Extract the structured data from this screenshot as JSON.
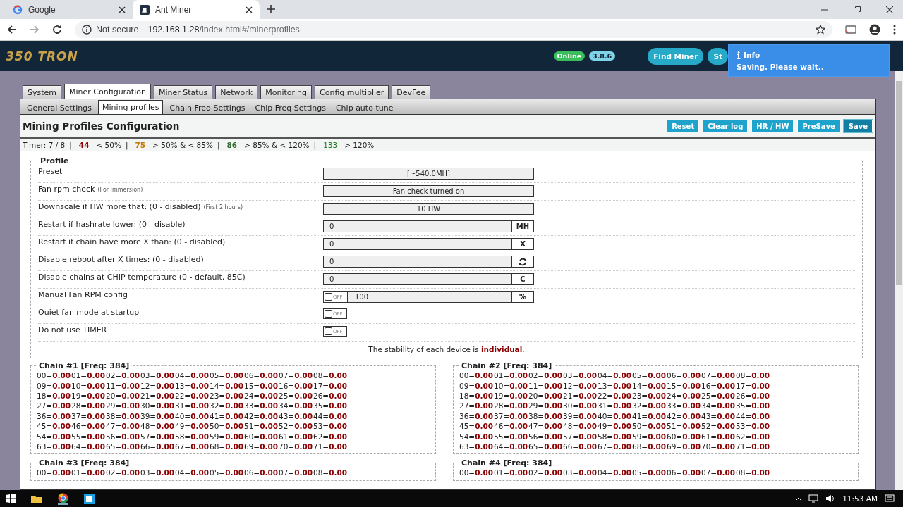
{
  "browser": {
    "tabs": [
      {
        "title": "Google",
        "selected": false
      },
      {
        "title": "Ant Miner",
        "selected": true
      }
    ],
    "security": "Not secure",
    "url_host": "192.168.1.28",
    "url_path": "/index.html#/minerprofiles"
  },
  "header": {
    "logo": "350 TRON",
    "badges": [
      {
        "label": "Online",
        "kind": "status"
      },
      {
        "label": "3.8.6",
        "kind": "version"
      }
    ],
    "buttons": [
      "Find Miner",
      "St"
    ]
  },
  "toast": {
    "title": "Info",
    "message": "Saving. Please wait.."
  },
  "main_tabs": [
    {
      "label": "System",
      "selected": false
    },
    {
      "label": "Miner Configuration",
      "selected": true
    },
    {
      "label": "Miner Status",
      "selected": false
    },
    {
      "label": "Network",
      "selected": false
    },
    {
      "label": "Monitoring",
      "selected": false
    },
    {
      "label": "Config multiplier",
      "selected": false
    },
    {
      "label": "DevFee",
      "selected": false
    }
  ],
  "sub_tabs": [
    {
      "label": "General Settings",
      "selected": false
    },
    {
      "label": "Mining profiles",
      "selected": true
    },
    {
      "label": "Chain Freq Settings",
      "selected": false
    },
    {
      "label": "Chip Freq Settings",
      "selected": false
    },
    {
      "label": "Chip auto tune",
      "selected": false
    }
  ],
  "title": "Mining Profiles Configuration",
  "actions": [
    {
      "label": "Reset",
      "pressed": false
    },
    {
      "label": "Clear log",
      "pressed": false
    },
    {
      "label": "HR / HW",
      "pressed": false
    },
    {
      "label": "PreSave",
      "pressed": false
    },
    {
      "label": "Save",
      "pressed": true
    }
  ],
  "timer": {
    "label": "Timer: 7 / 8",
    "legend": [
      {
        "separator": "|",
        "count": "44",
        "range": "< 50%",
        "color": "#8b0000"
      },
      {
        "separator": "|",
        "count": "75",
        "range": "> 50% & < 85%",
        "color": "#c07800"
      },
      {
        "separator": "|",
        "count": "86",
        "range": "> 85% & < 120%",
        "color": "#2e6b2e"
      },
      {
        "separator": "|",
        "count": "133",
        "range": "> 120%",
        "color": "#1e7a1e"
      }
    ]
  },
  "profile": {
    "legend": "Profile",
    "rows": [
      {
        "label": "Preset",
        "kind": "select",
        "value": "[~540.0MH]"
      },
      {
        "label": "Fan rpm check",
        "note": "(For Immersion)",
        "kind": "select",
        "value": "Fan check turned on"
      },
      {
        "label": "Downscale if HW more that: (0 - disabled)",
        "note": "(First 2 hours)",
        "kind": "select",
        "value": "10 HW"
      },
      {
        "label": "Restart if hashrate lower: (0 - disable)",
        "kind": "input",
        "value": "0",
        "unit": "MH"
      },
      {
        "label": "Restart if chain have more X than: (0 - disabled)",
        "kind": "input",
        "value": "0",
        "unit": "X"
      },
      {
        "label": "Disable reboot after X times: (0 - disabled)",
        "kind": "input-icon",
        "value": "0"
      },
      {
        "label": "Disable chains at CHIP temperature (0 - default, 85C)",
        "kind": "input",
        "value": "0",
        "unit": "C"
      },
      {
        "label": "Manual Fan RPM config",
        "kind": "toggle-input",
        "checked": false,
        "toggle_label": "OFF",
        "value": "100",
        "unit": "%"
      },
      {
        "label": "Quiet fan mode at startup",
        "kind": "toggle",
        "checked": false,
        "toggle_label": "OFF"
      },
      {
        "label": "Do not use TIMER",
        "kind": "toggle",
        "checked": false,
        "toggle_label": "OFF"
      }
    ],
    "footer": "The stability of each device is **individual**."
  },
  "chains": [
    {
      "title": "Chain #1 [Freq: 384]",
      "separator": "=",
      "rows": [
        [
          {
            "chip": "00",
            "value": "0.00"
          },
          {
            "chip": "01",
            "value": "0.00"
          },
          {
            "chip": "02",
            "value": "0.00"
          },
          {
            "chip": "03",
            "value": "0.00"
          },
          {
            "chip": "04",
            "value": "0.00"
          },
          {
            "chip": "05",
            "value": "0.00"
          },
          {
            "chip": "06",
            "value": "0.00"
          },
          {
            "chip": "07",
            "value": "0.00"
          },
          {
            "chip": "08",
            "value": "0.00"
          }
        ],
        [
          {
            "chip": "09",
            "value": "0.00"
          },
          {
            "chip": "10",
            "value": "0.00"
          },
          {
            "chip": "11",
            "value": "0.00"
          },
          {
            "chip": "12",
            "value": "0.00"
          },
          {
            "chip": "13",
            "value": "0.00"
          },
          {
            "chip": "14",
            "value": "0.00"
          },
          {
            "chip": "15",
            "value": "0.00"
          },
          {
            "chip": "16",
            "value": "0.00"
          },
          {
            "chip": "17",
            "value": "0.00"
          }
        ],
        [
          {
            "chip": "18",
            "value": "0.00"
          },
          {
            "chip": "19",
            "value": "0.00"
          },
          {
            "chip": "20",
            "value": "0.00"
          },
          {
            "chip": "21",
            "value": "0.00"
          },
          {
            "chip": "22",
            "value": "0.00"
          },
          {
            "chip": "23",
            "value": "0.00"
          },
          {
            "chip": "24",
            "value": "0.00"
          },
          {
            "chip": "25",
            "value": "0.00"
          },
          {
            "chip": "26",
            "value": "0.00"
          }
        ],
        [
          {
            "chip": "27",
            "value": "0.00"
          },
          {
            "chip": "28",
            "value": "0.00"
          },
          {
            "chip": "29",
            "value": "0.00"
          },
          {
            "chip": "30",
            "value": "0.00"
          },
          {
            "chip": "31",
            "value": "0.00"
          },
          {
            "chip": "32",
            "value": "0.00"
          },
          {
            "chip": "33",
            "value": "0.00"
          },
          {
            "chip": "34",
            "value": "0.00"
          },
          {
            "chip": "35",
            "value": "0.00"
          }
        ],
        [
          {
            "chip": "36",
            "value": "0.00"
          },
          {
            "chip": "37",
            "value": "0.00"
          },
          {
            "chip": "38",
            "value": "0.00"
          },
          {
            "chip": "39",
            "value": "0.00"
          },
          {
            "chip": "40",
            "value": "0.00"
          },
          {
            "chip": "41",
            "value": "0.00"
          },
          {
            "chip": "42",
            "value": "0.00"
          },
          {
            "chip": "43",
            "value": "0.00"
          },
          {
            "chip": "44",
            "value": "0.00"
          }
        ],
        [
          {
            "chip": "45",
            "value": "0.00"
          },
          {
            "chip": "46",
            "value": "0.00"
          },
          {
            "chip": "47",
            "value": "0.00"
          },
          {
            "chip": "48",
            "value": "0.00"
          },
          {
            "chip": "49",
            "value": "0.00"
          },
          {
            "chip": "50",
            "value": "0.00"
          },
          {
            "chip": "51",
            "value": "0.00"
          },
          {
            "chip": "52",
            "value": "0.00"
          },
          {
            "chip": "53",
            "value": "0.00"
          }
        ],
        [
          {
            "chip": "54",
            "value": "0.00"
          },
          {
            "chip": "55",
            "value": "0.00"
          },
          {
            "chip": "56",
            "value": "0.00"
          },
          {
            "chip": "57",
            "value": "0.00"
          },
          {
            "chip": "58",
            "value": "0.00"
          },
          {
            "chip": "59",
            "value": "0.00"
          },
          {
            "chip": "60",
            "value": "0.00"
          },
          {
            "chip": "61",
            "value": "0.00"
          },
          {
            "chip": "62",
            "value": "0.00"
          }
        ],
        [
          {
            "chip": "63",
            "value": "0.00"
          },
          {
            "chip": "64",
            "value": "0.00"
          },
          {
            "chip": "65",
            "value": "0.00"
          },
          {
            "chip": "66",
            "value": "0.00"
          },
          {
            "chip": "67",
            "value": "0.00"
          },
          {
            "chip": "68",
            "value": "0.00"
          },
          {
            "chip": "69",
            "value": "0.00"
          },
          {
            "chip": "70",
            "value": "0.00"
          },
          {
            "chip": "71",
            "value": "0.00"
          }
        ]
      ]
    },
    {
      "title": "Chain #2 [Freq: 384]",
      "separator": "=",
      "rows": [
        [
          {
            "chip": "00",
            "value": "0.00"
          },
          {
            "chip": "01",
            "value": "0.00"
          },
          {
            "chip": "02",
            "value": "0.00"
          },
          {
            "chip": "03",
            "value": "0.00"
          },
          {
            "chip": "04",
            "value": "0.00"
          },
          {
            "chip": "05",
            "value": "0.00"
          },
          {
            "chip": "06",
            "value": "0.00"
          },
          {
            "chip": "07",
            "value": "0.00"
          },
          {
            "chip": "08",
            "value": "0.00"
          }
        ],
        [
          {
            "chip": "09",
            "value": "0.00"
          },
          {
            "chip": "10",
            "value": "0.00"
          },
          {
            "chip": "11",
            "value": "0.00"
          },
          {
            "chip": "12",
            "value": "0.00"
          },
          {
            "chip": "13",
            "value": "0.00"
          },
          {
            "chip": "14",
            "value": "0.00"
          },
          {
            "chip": "15",
            "value": "0.00"
          },
          {
            "chip": "16",
            "value": "0.00"
          },
          {
            "chip": "17",
            "value": "0.00"
          }
        ],
        [
          {
            "chip": "18",
            "value": "0.00"
          },
          {
            "chip": "19",
            "value": "0.00"
          },
          {
            "chip": "20",
            "value": "0.00"
          },
          {
            "chip": "21",
            "value": "0.00"
          },
          {
            "chip": "22",
            "value": "0.00"
          },
          {
            "chip": "23",
            "value": "0.00"
          },
          {
            "chip": "24",
            "value": "0.00"
          },
          {
            "chip": "25",
            "value": "0.00"
          },
          {
            "chip": "26",
            "value": "0.00"
          }
        ],
        [
          {
            "chip": "27",
            "value": "0.00"
          },
          {
            "chip": "28",
            "value": "0.00"
          },
          {
            "chip": "29",
            "value": "0.00"
          },
          {
            "chip": "30",
            "value": "0.00"
          },
          {
            "chip": "31",
            "value": "0.00"
          },
          {
            "chip": "32",
            "value": "0.00"
          },
          {
            "chip": "33",
            "value": "0.00"
          },
          {
            "chip": "34",
            "value": "0.00"
          },
          {
            "chip": "35",
            "value": "0.00"
          }
        ],
        [
          {
            "chip": "36",
            "value": "0.00"
          },
          {
            "chip": "37",
            "value": "0.00"
          },
          {
            "chip": "38",
            "value": "0.00"
          },
          {
            "chip": "39",
            "value": "0.00"
          },
          {
            "chip": "40",
            "value": "0.00"
          },
          {
            "chip": "41",
            "value": "0.00"
          },
          {
            "chip": "42",
            "value": "0.00"
          },
          {
            "chip": "43",
            "value": "0.00"
          },
          {
            "chip": "44",
            "value": "0.00"
          }
        ],
        [
          {
            "chip": "45",
            "value": "0.00"
          },
          {
            "chip": "46",
            "value": "0.00"
          },
          {
            "chip": "47",
            "value": "0.00"
          },
          {
            "chip": "48",
            "value": "0.00"
          },
          {
            "chip": "49",
            "value": "0.00"
          },
          {
            "chip": "50",
            "value": "0.00"
          },
          {
            "chip": "51",
            "value": "0.00"
          },
          {
            "chip": "52",
            "value": "0.00"
          },
          {
            "chip": "53",
            "value": "0.00"
          }
        ],
        [
          {
            "chip": "54",
            "value": "0.00"
          },
          {
            "chip": "55",
            "value": "0.00"
          },
          {
            "chip": "56",
            "value": "0.00"
          },
          {
            "chip": "57",
            "value": "0.00"
          },
          {
            "chip": "58",
            "value": "0.00"
          },
          {
            "chip": "59",
            "value": "0.00"
          },
          {
            "chip": "60",
            "value": "0.00"
          },
          {
            "chip": "61",
            "value": "0.00"
          },
          {
            "chip": "62",
            "value": "0.00"
          }
        ],
        [
          {
            "chip": "63",
            "value": "0.00"
          },
          {
            "chip": "64",
            "value": "0.00"
          },
          {
            "chip": "65",
            "value": "0.00"
          },
          {
            "chip": "66",
            "value": "0.00"
          },
          {
            "chip": "67",
            "value": "0.00"
          },
          {
            "chip": "68",
            "value": "0.00"
          },
          {
            "chip": "69",
            "value": "0.00"
          },
          {
            "chip": "70",
            "value": "0.00"
          },
          {
            "chip": "71",
            "value": "0.00"
          }
        ]
      ]
    },
    {
      "title": "Chain #3 [Freq: 384]",
      "separator": "=",
      "rows": [
        [
          {
            "chip": "00",
            "value": "0.00"
          },
          {
            "chip": "01",
            "value": "0.00"
          },
          {
            "chip": "02",
            "value": "0.00"
          },
          {
            "chip": "03",
            "value": "0.00"
          },
          {
            "chip": "04",
            "value": "0.00"
          },
          {
            "chip": "05",
            "value": "0.00"
          },
          {
            "chip": "06",
            "value": "0.00"
          },
          {
            "chip": "07",
            "value": "0.00"
          },
          {
            "chip": "08",
            "value": "0.00"
          }
        ]
      ]
    },
    {
      "title": "Chain #4 [Freq: 384]",
      "separator": "=",
      "rows": [
        [
          {
            "chip": "00",
            "value": "0.00"
          },
          {
            "chip": "01",
            "value": "0.00"
          },
          {
            "chip": "02",
            "value": "0.00"
          },
          {
            "chip": "03",
            "value": "0.00"
          },
          {
            "chip": "04",
            "value": "0.00"
          },
          {
            "chip": "05",
            "value": "0.00"
          },
          {
            "chip": "06",
            "value": "0.00"
          },
          {
            "chip": "07",
            "value": "0.00"
          },
          {
            "chip": "08",
            "value": "0.00"
          }
        ]
      ]
    }
  ],
  "taskbar": {
    "time": "11:53 AM"
  }
}
